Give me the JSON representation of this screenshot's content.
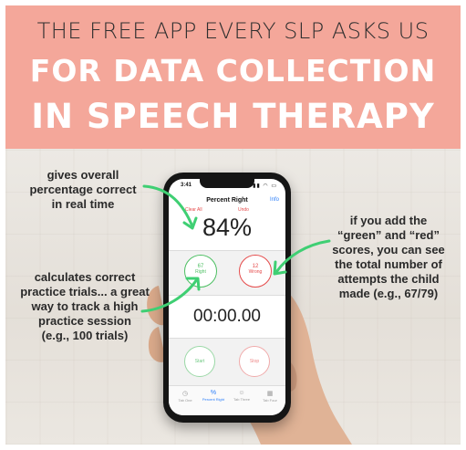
{
  "banner": {
    "line1": "THE FREE APP EVERY SLP ASKS US",
    "line2": "FOR DATA COLLECTION",
    "line3": "IN SPEECH THERAPY"
  },
  "colors": {
    "banner": "#f4a79a",
    "arrow": "#3fcf73",
    "right": "#4cbf62",
    "wrong": "#e54b4b",
    "link": "#2d7ff9"
  },
  "annotations": {
    "top_left": [
      "gives overall",
      "percentage correct",
      "in real time"
    ],
    "right": [
      "if you add the",
      "“green” and “red”",
      "scores, you can see",
      "the total number of",
      "attempts the child",
      "made (e.g., 67/79)"
    ],
    "bottom_left": [
      "calculates correct",
      "practice trials... a great",
      "way to track a high",
      "practice session",
      "(e.g., 100 trials)"
    ]
  },
  "app": {
    "clock": "3:41",
    "title": "Percent Right",
    "info": "Info",
    "clear_all": "Clear All",
    "undo": "Undo",
    "percent": "84%",
    "right_count": "67",
    "right_label": "Right",
    "wrong_count": "12",
    "wrong_label": "Wrong",
    "timer": "00:00.00",
    "start_label": "Start",
    "stop_label": "Stop",
    "tabs": [
      {
        "label": "Tab One",
        "icon": "clock-icon"
      },
      {
        "label": "Percent Right",
        "icon": "percent-icon"
      },
      {
        "label": "Tab Three",
        "icon": "person-icon"
      },
      {
        "label": "Tab Four",
        "icon": "grid-icon"
      }
    ]
  }
}
